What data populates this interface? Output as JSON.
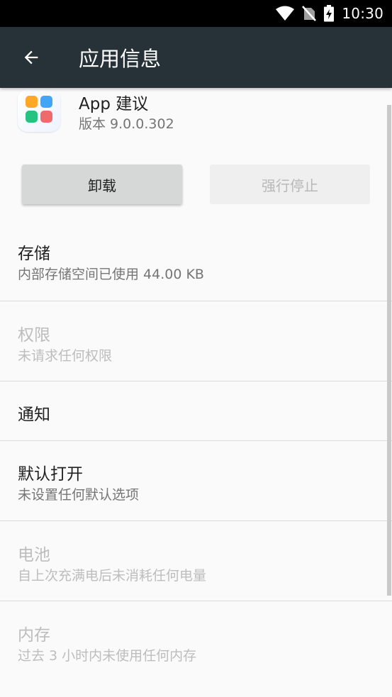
{
  "status_bar": {
    "time": "10:30",
    "icons": [
      "wifi-icon",
      "no-sim-icon",
      "battery-charging-icon"
    ]
  },
  "toolbar": {
    "back_icon": "arrow-back-icon",
    "title": "应用信息"
  },
  "app": {
    "name": "App 建议",
    "version": "版本 9.0.0.302",
    "icon": "app-grid-icon"
  },
  "buttons": {
    "uninstall": "卸载",
    "force_stop": "强行停止"
  },
  "items": [
    {
      "title": "存储",
      "summary": "内部存储空间已使用 44.00 KB",
      "enabled": true
    },
    {
      "title": "权限",
      "summary": "未请求任何权限",
      "enabled": false
    },
    {
      "title": "通知",
      "summary": "",
      "enabled": true
    },
    {
      "title": "默认打开",
      "summary": "未设置任何默认选项",
      "enabled": true
    },
    {
      "title": "电池",
      "summary": "自上次充满电后未消耗任何电量",
      "enabled": false
    },
    {
      "title": "内存",
      "summary": "过去 3 小时内未使用任何内存",
      "enabled": false
    }
  ],
  "colors": {
    "toolbar": "#263238",
    "status_bar": "#000000",
    "background": "#fafafa",
    "text_primary": "#212121",
    "text_secondary": "#757575",
    "text_disabled": "#bdbdbd"
  }
}
